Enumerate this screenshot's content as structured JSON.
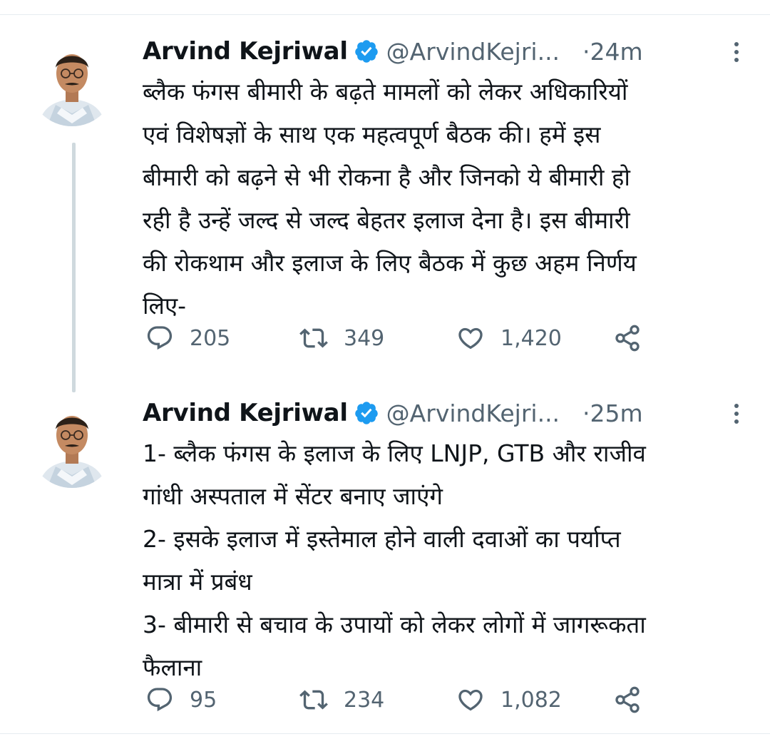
{
  "tweets": [
    {
      "author_name": "Arvind Kejriwal",
      "handle": "@ArvindKejri...",
      "dot": "·",
      "time": "24m",
      "lines": [
        "ब्लैक फंगस बीमारी के बढ़ते मामलों को लेकर अधिकारियों",
        "एवं विशेषज्ञों के साथ एक महत्वपूर्ण बैठक की। हमें इस",
        "बीमारी को बढ़ने से भी रोकना है और जिनको ये बीमारी हो",
        "रही है उन्हें जल्द से जल्द बेहतर इलाज देना है। इस बीमारी",
        "की रोकथाम और इलाज के लिए बैठक में कुछ अहम निर्णय",
        "लिए-"
      ],
      "replies": "205",
      "retweets": "349",
      "likes": "1,420"
    },
    {
      "author_name": "Arvind Kejriwal",
      "handle": "@ArvindKejri...",
      "dot": "·",
      "time": "25m",
      "lines": [
        "1- ब्लैक फंगस के इलाज के लिए LNJP, GTB और राजीव",
        "गांधी अस्पताल में सेंटर बनाए जाएंगे",
        "2- इसके इलाज में इस्तेमाल होने वाली दवाओं का पर्याप्त",
        "मात्रा में प्रबंध",
        "3- बीमारी से बचाव के उपायों को लेकर लोगों में जागरूकता",
        "फैलाना"
      ],
      "replies": "95",
      "retweets": "234",
      "likes": "1,082"
    }
  ],
  "colors": {
    "text_primary": "#0f1419",
    "text_secondary": "#536471",
    "verified_blue": "#1d9bf0",
    "thread_line": "#cfd9de",
    "divider": "#e6ecf0"
  },
  "icons": {
    "reply": "reply-icon",
    "retweet": "retweet-icon",
    "like": "heart-icon",
    "share": "share-icon",
    "verified": "verified-badge-icon",
    "more": "more-options-icon"
  }
}
